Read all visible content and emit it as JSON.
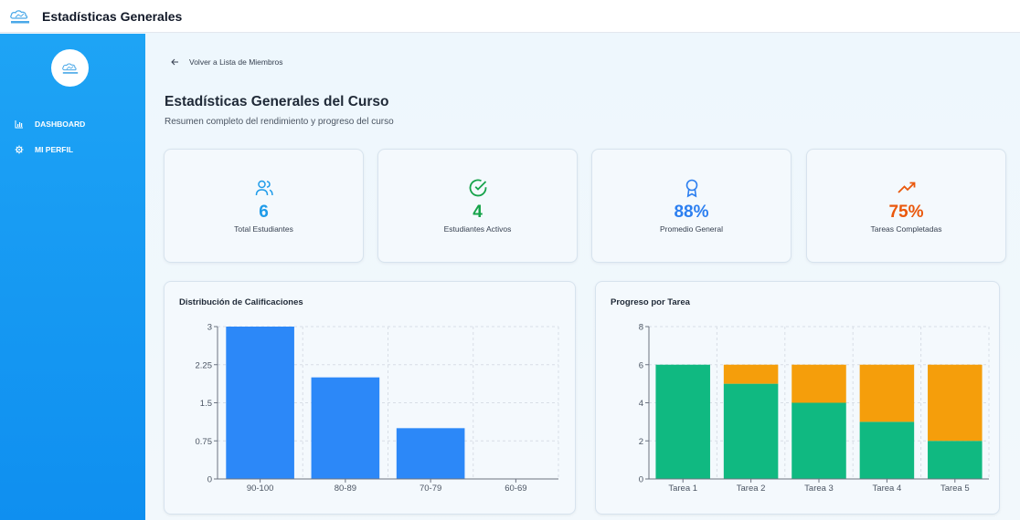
{
  "app": {
    "title": "Estadísticas Generales"
  },
  "sidebar": {
    "items": [
      {
        "label": "DASHBOARD",
        "icon": "bar-chart-icon"
      },
      {
        "label": "MI PERFIL",
        "icon": "gear-icon"
      }
    ]
  },
  "main": {
    "back_label": "Volver a Lista de Miembros",
    "title": "Estadísticas Generales del Curso",
    "subtitle": "Resumen completo del rendimiento y progreso del curso"
  },
  "stats": [
    {
      "value": "6",
      "label": "Total Estudiantes",
      "icon": "users-icon",
      "color": "#1e9be9"
    },
    {
      "value": "4",
      "label": "Estudiantes Activos",
      "icon": "check-circle-icon",
      "color": "#16a34a"
    },
    {
      "value": "88%",
      "label": "Promedio General",
      "icon": "award-icon",
      "color": "#2c7ff0"
    },
    {
      "value": "75%",
      "label": "Tareas Completadas",
      "icon": "trending-up-icon",
      "color": "#ea580c"
    }
  ],
  "colors": {
    "bar": "#2c88f8",
    "completed": "#10b981",
    "pending": "#f59e0b",
    "sidebar": "#1ea4f5"
  },
  "chart_data": [
    {
      "type": "bar",
      "title": "Distribución de Calificaciones",
      "categories": [
        "90-100",
        "80-89",
        "70-79",
        "60-69"
      ],
      "values": [
        3,
        2,
        1,
        0
      ],
      "ylim": [
        0,
        3
      ],
      "yticks": [
        "0",
        "0.75",
        "1.5",
        "2.25",
        "3"
      ],
      "grid": true
    },
    {
      "type": "bar",
      "stacked": true,
      "title": "Progreso por Tarea",
      "categories": [
        "Tarea 1",
        "Tarea 2",
        "Tarea 3",
        "Tarea 4",
        "Tarea 5"
      ],
      "series": [
        {
          "values": [
            6,
            5,
            4,
            3,
            2
          ]
        },
        {
          "values": [
            0,
            1,
            2,
            3,
            4
          ]
        }
      ],
      "ylim": [
        0,
        8
      ],
      "yticks": [
        "0",
        "2",
        "4",
        "6",
        "8"
      ],
      "grid": true
    }
  ]
}
